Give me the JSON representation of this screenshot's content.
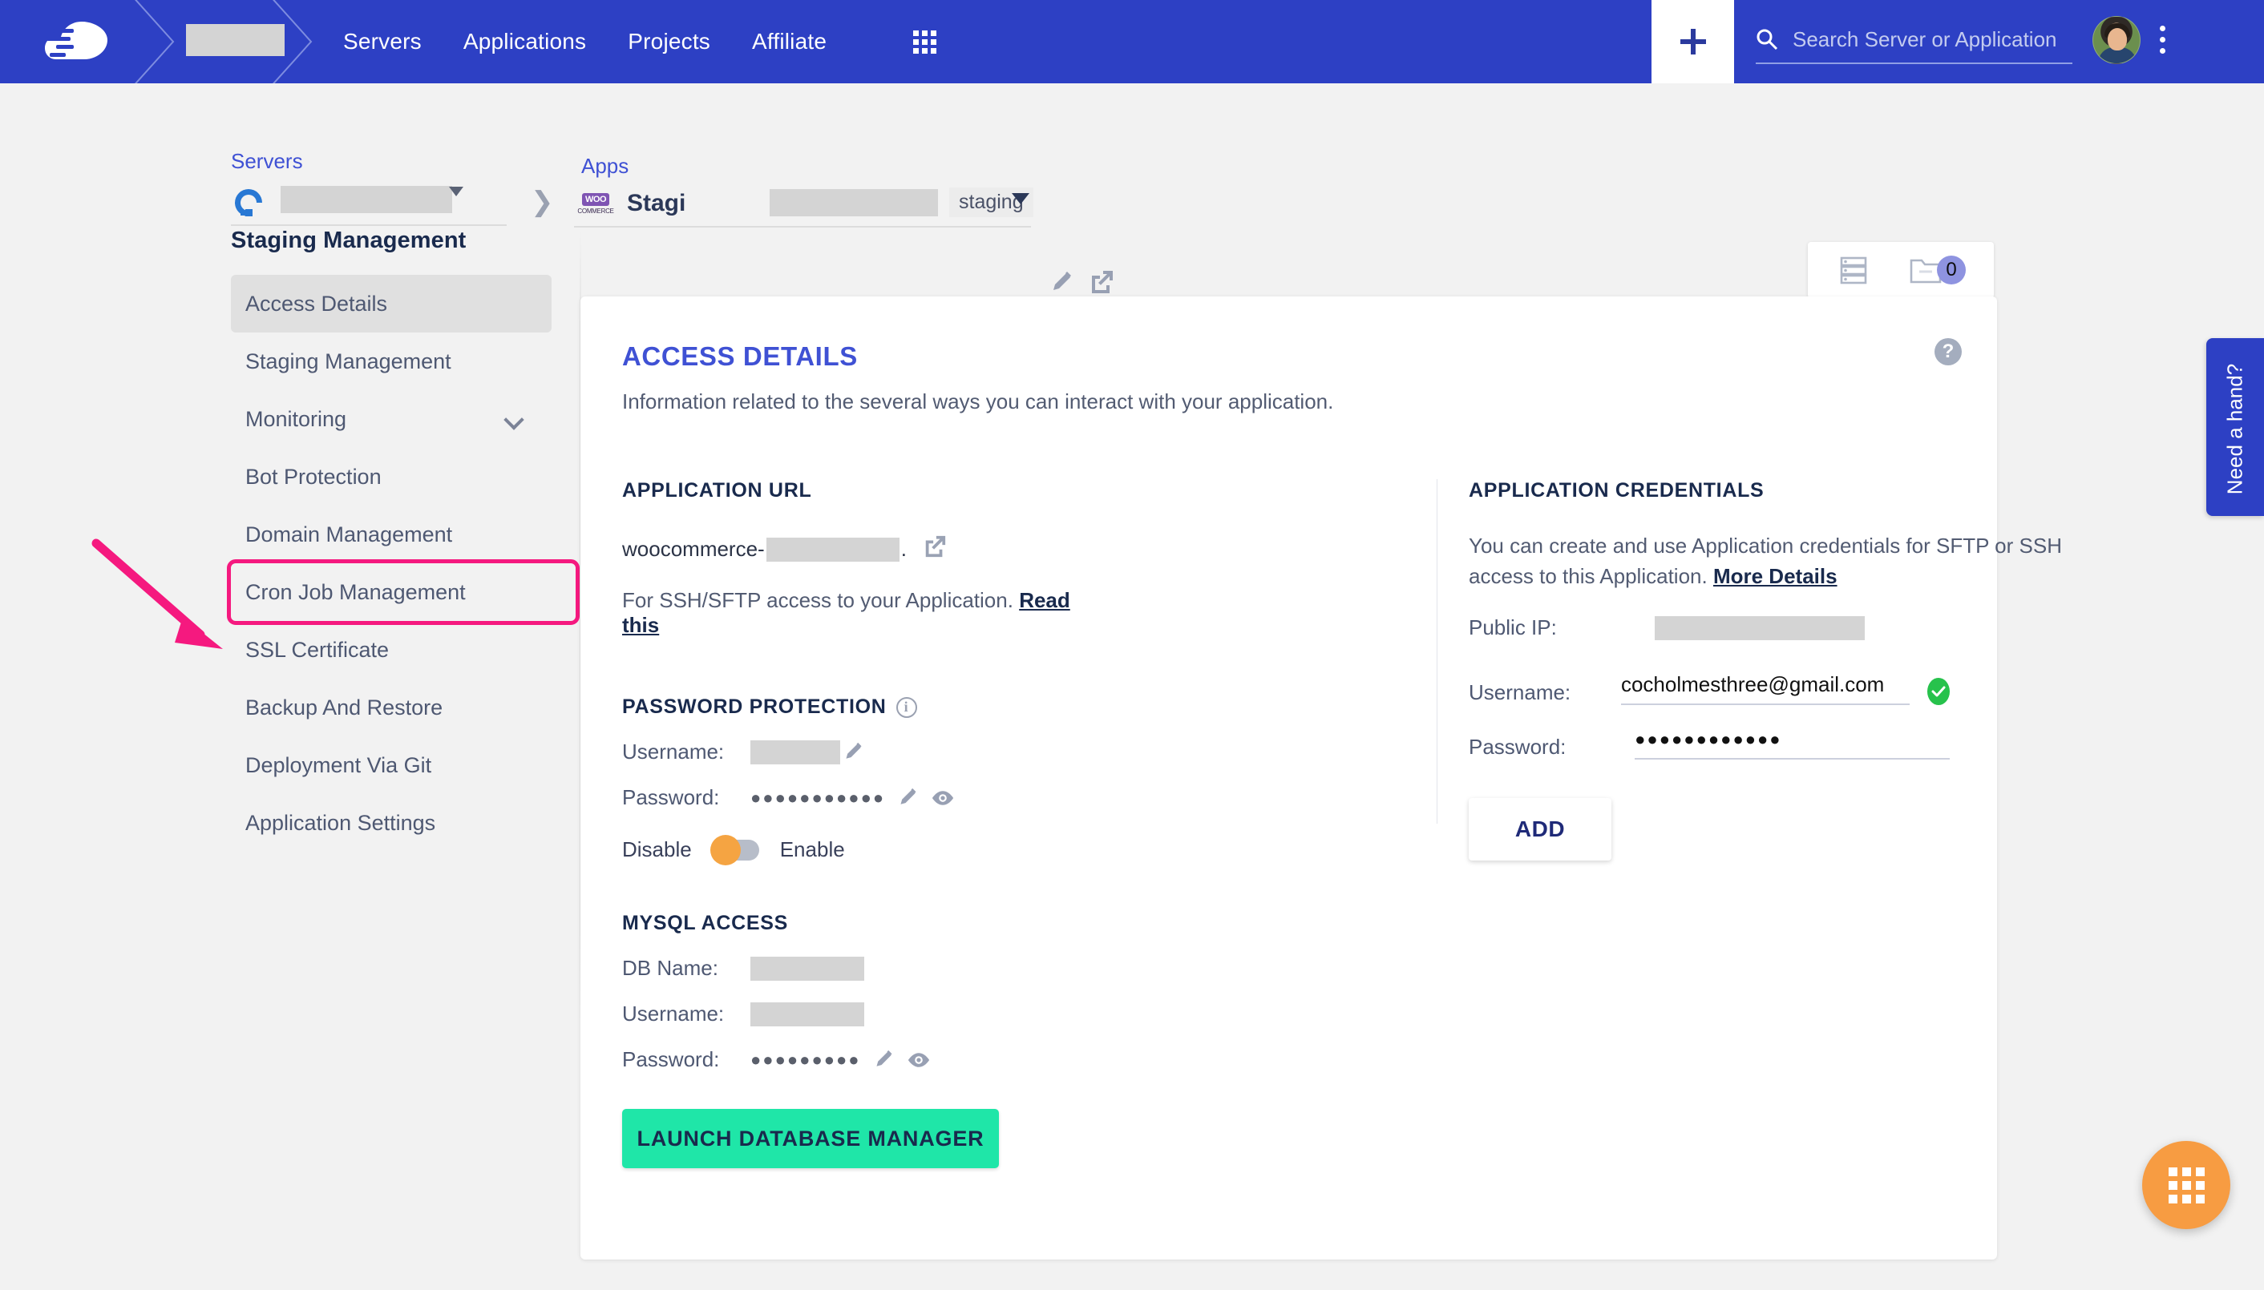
{
  "navbar": {
    "logo_icon": "cloudways-cloud-logo",
    "account_redacted": "",
    "links": [
      {
        "label": "Servers"
      },
      {
        "label": "Applications"
      },
      {
        "label": "Projects"
      },
      {
        "label": "Affiliate"
      }
    ],
    "grid_icon": "apps-grid-icon",
    "plus_icon": "plus-icon",
    "search": {
      "icon": "search-icon",
      "placeholder": "Search Server or Application",
      "value": ""
    },
    "avatar_icon": "user-avatar",
    "kebab_icon": "vertical-dots-icon"
  },
  "breadcrumb": {
    "servers_label": "Servers",
    "apps_label": "Apps",
    "server_icon": "digitalocean-icon",
    "server_name_redacted": "",
    "separator_icon": "chevron-right-icon",
    "app_platform_icon": "woocommerce-icon",
    "app_name": "Stagi",
    "app_name_redacted": "",
    "app_env_chip": "staging",
    "app_caret_icon": "caret-down-icon",
    "edit_icon": "pencil-icon",
    "open_icon": "external-link-icon"
  },
  "view_panel": {
    "list_icon": "server-list-icon",
    "folder_icon": "project-folder-icon",
    "count": "0",
    "count_color": "#8e93e0"
  },
  "sidebar": {
    "title": "Staging Management",
    "items": [
      {
        "label": "Access Details",
        "state": "active"
      },
      {
        "label": "Staging Management",
        "state": "default"
      },
      {
        "label": "Monitoring",
        "state": "default",
        "chevron": "chevron-down-icon"
      },
      {
        "label": "Bot Protection",
        "state": "default"
      },
      {
        "label": "Domain Management",
        "state": "default"
      },
      {
        "label": "Cron Job Management",
        "state": "highlighted"
      },
      {
        "label": "SSL Certificate",
        "state": "default"
      },
      {
        "label": "Backup And Restore",
        "state": "default"
      },
      {
        "label": "Deployment Via Git",
        "state": "default"
      },
      {
        "label": "Application Settings",
        "state": "default"
      }
    ],
    "highlight_color": "#f5197f"
  },
  "annotation": {
    "arrow_icon": "pink-pointer-arrow",
    "arrow_color": "#f5197f"
  },
  "card": {
    "title": "ACCESS DETAILS",
    "title_color": "#3f51d4",
    "subtitle": "Information related to the several ways you can interact with your application.",
    "help_icon": "question-mark-help-icon"
  },
  "application_url": {
    "heading": "APPLICATION URL",
    "url_prefix": "woocommerce-",
    "url_redacted": "",
    "url_suffix": ".",
    "open_icon": "external-link-icon",
    "ssh_note": "For SSH/SFTP access to your Application.",
    "ssh_link": "Read this"
  },
  "password_protection": {
    "heading": "PASSWORD PROTECTION",
    "info_icon": "info-circle-icon",
    "username_label": "Username:",
    "username_redacted": "",
    "username_edit_icon": "pencil-icon",
    "password_label": "Password:",
    "password_masked": "●●●●●●●●●●●",
    "password_edit_icon": "pencil-icon",
    "password_reveal_icon": "eye-icon",
    "toggle_off_label": "Disable",
    "toggle_on_label": "Enable",
    "toggle_state": "disabled",
    "toggle_knob_color": "#f5a442"
  },
  "mysql_access": {
    "heading": "MYSQL ACCESS",
    "db_name_label": "DB Name:",
    "db_name_redacted": "",
    "username_label": "Username:",
    "username_redacted": "",
    "password_label": "Password:",
    "password_masked": "●●●●●●●●●",
    "password_edit_icon": "pencil-icon",
    "password_reveal_icon": "eye-icon",
    "launch_button": "LAUNCH DATABASE MANAGER",
    "launch_button_color": "#1fe6a8"
  },
  "application_credentials": {
    "heading": "APPLICATION CREDENTIALS",
    "description": "You can create and use Application credentials for SFTP or SSH access to this Application.",
    "more_link": "More Details",
    "public_ip_label": "Public IP:",
    "public_ip_redacted": "",
    "username_label": "Username:",
    "username_value": "cocholmesthree@gmail.com",
    "valid_icon": "green-check-circle-icon",
    "valid_color": "#27c24c",
    "password_label": "Password:",
    "password_masked": "●●●●●●●●●●●●",
    "add_button": "ADD"
  },
  "widgets": {
    "need_hand_label": "Need a hand?",
    "need_hand_color": "#2d40c4",
    "fab_icon": "apps-grid-icon",
    "fab_color": "#f79c42"
  }
}
